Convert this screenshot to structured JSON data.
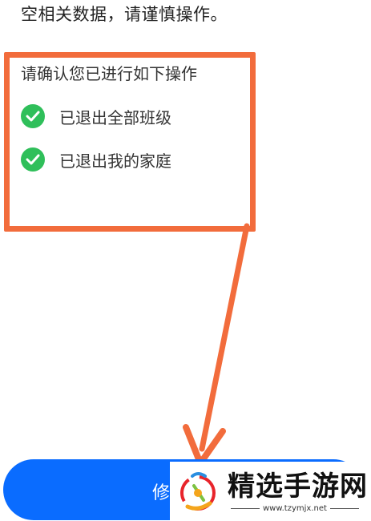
{
  "warning_text": "空相关数据，请谨慎操作。",
  "confirm_title": "请确认您已进行如下操作",
  "checklist": [
    {
      "label": "已退出全部班级",
      "icon": "check-circle-icon"
    },
    {
      "label": "已退出我的家庭",
      "icon": "check-circle-icon"
    }
  ],
  "primary_button": {
    "label": "修"
  },
  "watermark": {
    "name": "精选手游网",
    "url": "www.tzymjx.net"
  },
  "colors": {
    "highlight": "#f26c3c",
    "check": "#2fbf5a",
    "button": "#0a6cff"
  }
}
